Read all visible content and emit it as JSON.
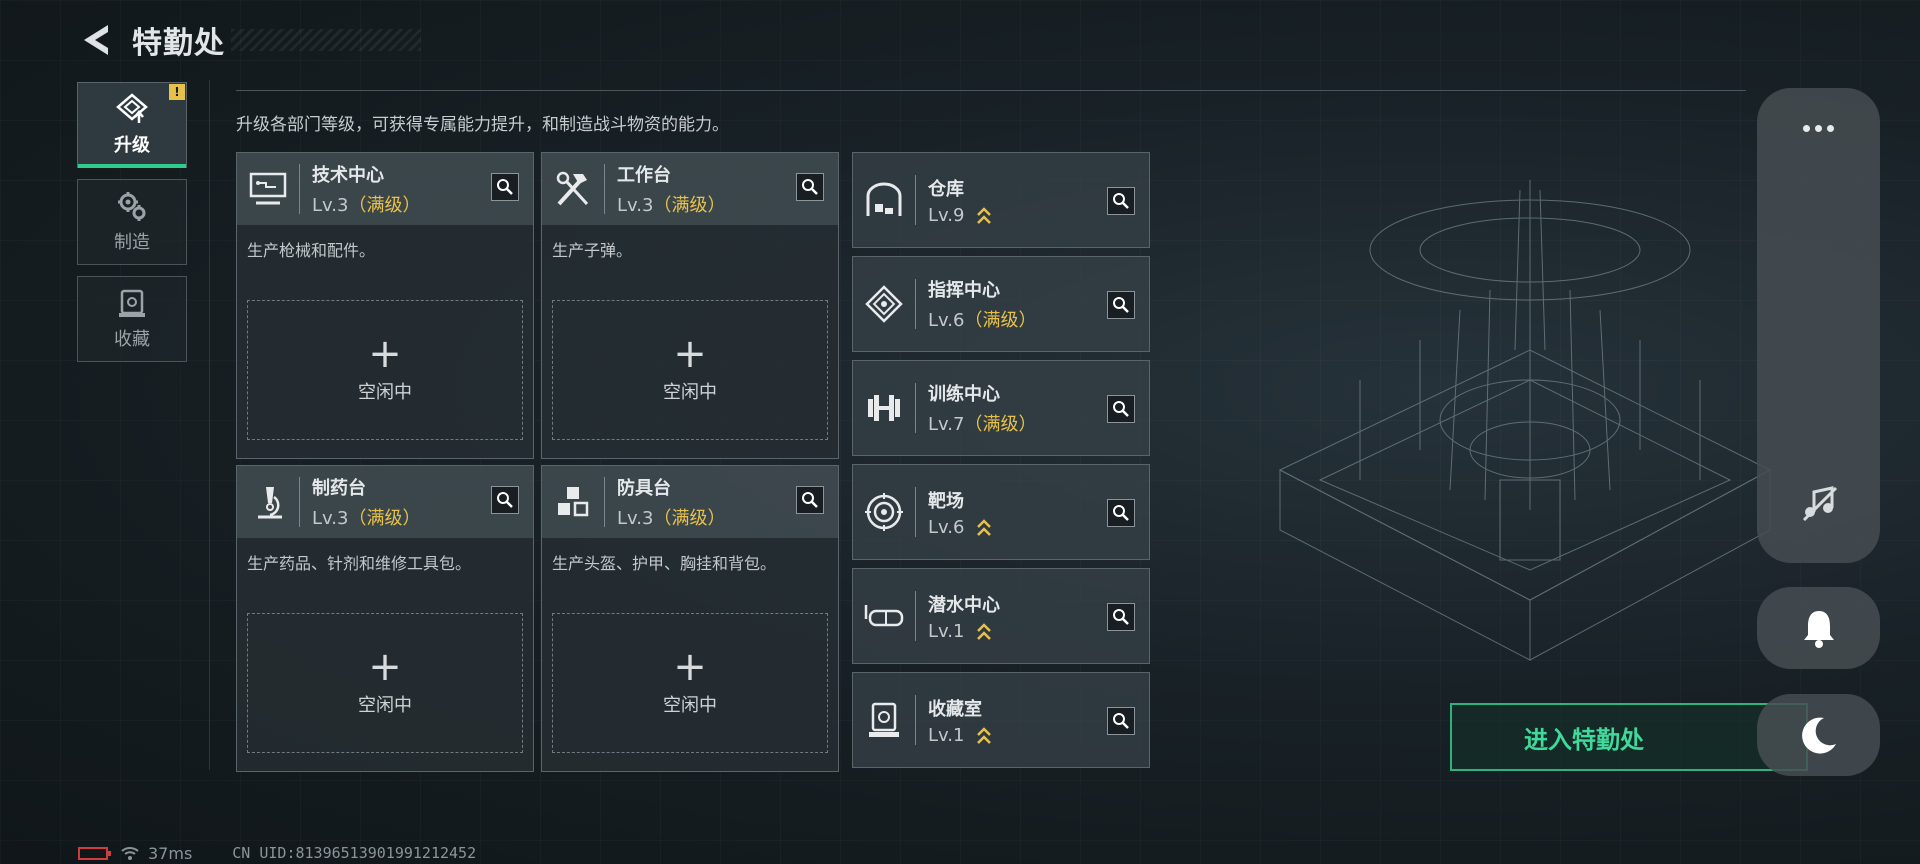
{
  "header": {
    "title": "特勤处"
  },
  "side_nav": [
    {
      "label": "升级",
      "icon": "upgrade-icon",
      "active": true,
      "badge": "!"
    },
    {
      "label": "制造",
      "icon": "gears-icon",
      "active": false
    },
    {
      "label": "收藏",
      "icon": "collection-icon",
      "active": false
    }
  ],
  "description": "升级各部门等级，可获得专属能力提升，和制造战斗物资的能力。",
  "production_cards": [
    {
      "name": "技术中心",
      "level": "Lv.3",
      "max_label": "（满级）",
      "desc": "生产枪械和配件。",
      "idle_plus": "+",
      "idle_label": "空闲中",
      "icon": "monitor-icon"
    },
    {
      "name": "工作台",
      "level": "Lv.3",
      "max_label": "（满级）",
      "desc": "生产子弹。",
      "idle_plus": "+",
      "idle_label": "空闲中",
      "icon": "tools-icon"
    },
    {
      "name": "制药台",
      "level": "Lv.3",
      "max_label": "（满级）",
      "desc": "生产药品、针剂和维修工具包。",
      "idle_plus": "+",
      "idle_label": "空闲中",
      "icon": "microscope-icon"
    },
    {
      "name": "防具台",
      "level": "Lv.3",
      "max_label": "（满级）",
      "desc": "生产头盔、护甲、胸挂和背包。",
      "idle_plus": "+",
      "idle_label": "空闲中",
      "icon": "cubes-icon"
    }
  ],
  "buildings": [
    {
      "name": "仓库",
      "level": "Lv.9",
      "max_label": "",
      "upgradable": true,
      "icon": "warehouse-icon"
    },
    {
      "name": "指挥中心",
      "level": "Lv.6",
      "max_label": "（满级）",
      "upgradable": false,
      "icon": "chip-icon"
    },
    {
      "name": "训练中心",
      "level": "Lv.7",
      "max_label": "（满级）",
      "upgradable": false,
      "icon": "dumbbell-icon"
    },
    {
      "name": "靶场",
      "level": "Lv.6",
      "max_label": "",
      "upgradable": true,
      "icon": "target-icon"
    },
    {
      "name": "潜水中心",
      "level": "Lv.1",
      "max_label": "",
      "upgradable": true,
      "icon": "diving-mask-icon"
    },
    {
      "name": "收藏室",
      "level": "Lv.1",
      "max_label": "",
      "upgradable": true,
      "icon": "vault-icon"
    }
  ],
  "enter_button": "进入特勤处",
  "footer": {
    "ping": "37ms",
    "uid": "CN UID:81396513901991212452"
  },
  "colors": {
    "accent_green": "#2ecc8e",
    "max_gold": "#e7c24a",
    "battery_red": "#d03b3b"
  }
}
